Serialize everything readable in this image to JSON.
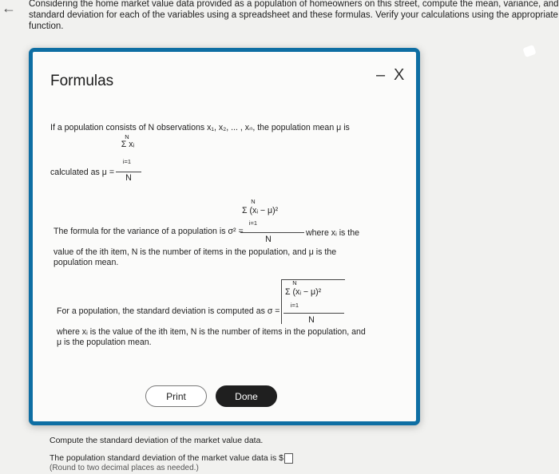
{
  "intro": {
    "line1": "Considering the home market value data provided as a population of homeowners on this street, compute the mean, variance, and",
    "line2": "standard deviation for each of the variables using a spreadsheet and these formulas. Verify your calculations using the appropriate E",
    "line3": "function."
  },
  "modal": {
    "title": "Formulas",
    "minimize": "–",
    "close": "X",
    "mean_intro": "If a population consists of N observations x₁, x₂, ... , xₙ, the population mean μ is",
    "mean_label": "calculated as μ =",
    "mean_num_sigma": "Σ xᵢ",
    "mean_num_top": "N",
    "mean_num_bottom": "i=1",
    "mean_den": "N",
    "var_sum_top": "N",
    "var_num": "Σ (xᵢ − μ)²",
    "var_sum_bottom": "i=1",
    "var_den": "N",
    "var_line1": "The formula for the variance of a population is σ² =",
    "var_where": "where xᵢ is the",
    "var_line2": "value of the ith item, N is the number of items in the population, and μ is the",
    "var_line3": "population mean.",
    "sd_sum_top": "N",
    "sd_num": "Σ (xᵢ − μ)²",
    "sd_sum_bottom": "i=1",
    "sd_den": "N",
    "sd_line1": "For a population, the standard deviation is computed as σ =",
    "sd_line2": "where xᵢ is the value of the ith item, N is the number of items in the population, and",
    "sd_line3": "μ is the population mean.",
    "print_label": "Print",
    "done_label": "Done"
  },
  "footer": {
    "question": "Compute the standard deviation of the market value data.",
    "answer_prefix": "The population standard deviation of the market value data is $",
    "round_note": "(Round to two decimal places as needed.)"
  }
}
